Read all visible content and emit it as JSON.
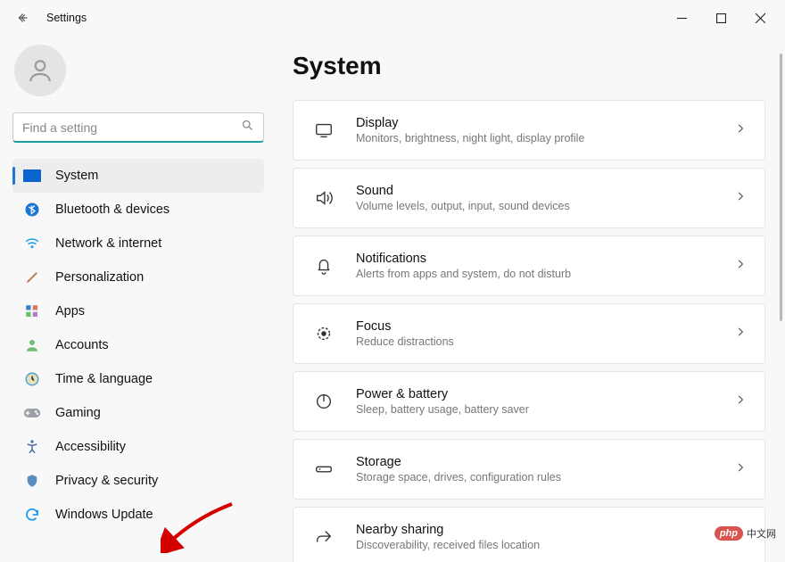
{
  "window": {
    "app_title": "Settings"
  },
  "search": {
    "placeholder": "Find a setting",
    "value": ""
  },
  "sidebar": {
    "items": [
      {
        "label": "System",
        "icon": "system",
        "selected": true
      },
      {
        "label": "Bluetooth & devices",
        "icon": "bluetooth"
      },
      {
        "label": "Network & internet",
        "icon": "wifi"
      },
      {
        "label": "Personalization",
        "icon": "brush"
      },
      {
        "label": "Apps",
        "icon": "apps"
      },
      {
        "label": "Accounts",
        "icon": "person"
      },
      {
        "label": "Time & language",
        "icon": "clock"
      },
      {
        "label": "Gaming",
        "icon": "gamepad"
      },
      {
        "label": "Accessibility",
        "icon": "accessibility"
      },
      {
        "label": "Privacy & security",
        "icon": "shield"
      },
      {
        "label": "Windows Update",
        "icon": "update"
      }
    ]
  },
  "page": {
    "title": "System",
    "cards": [
      {
        "title": "Display",
        "subtitle": "Monitors, brightness, night light, display profile",
        "icon": "display"
      },
      {
        "title": "Sound",
        "subtitle": "Volume levels, output, input, sound devices",
        "icon": "sound"
      },
      {
        "title": "Notifications",
        "subtitle": "Alerts from apps and system, do not disturb",
        "icon": "bell"
      },
      {
        "title": "Focus",
        "subtitle": "Reduce distractions",
        "icon": "focus"
      },
      {
        "title": "Power & battery",
        "subtitle": "Sleep, battery usage, battery saver",
        "icon": "power"
      },
      {
        "title": "Storage",
        "subtitle": "Storage space, drives, configuration rules",
        "icon": "storage"
      },
      {
        "title": "Nearby sharing",
        "subtitle": "Discoverability, received files location",
        "icon": "share"
      }
    ]
  },
  "watermark": {
    "badge": "php",
    "text": "中文网"
  }
}
